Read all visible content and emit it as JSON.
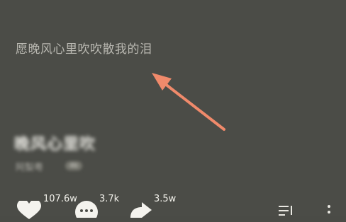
{
  "lyric": {
    "current_line": "愿晚风心里吹吹散我的泪"
  },
  "song": {
    "title": "晚风心里吹",
    "artist": "阿梨粤",
    "badge": "4k"
  },
  "actions": {
    "like_count": "107.6w",
    "comment_count": "3.7k",
    "share_count": "3.5w"
  },
  "icons": {
    "like": "heart-icon",
    "comment": "comment-icon",
    "share": "share-icon",
    "playlist": "playlist-icon",
    "more": "more-icon"
  },
  "colors": {
    "background": "#4b4c47",
    "annotation_arrow": "#f08a6b",
    "lyric_text": "#b9b8b1"
  }
}
